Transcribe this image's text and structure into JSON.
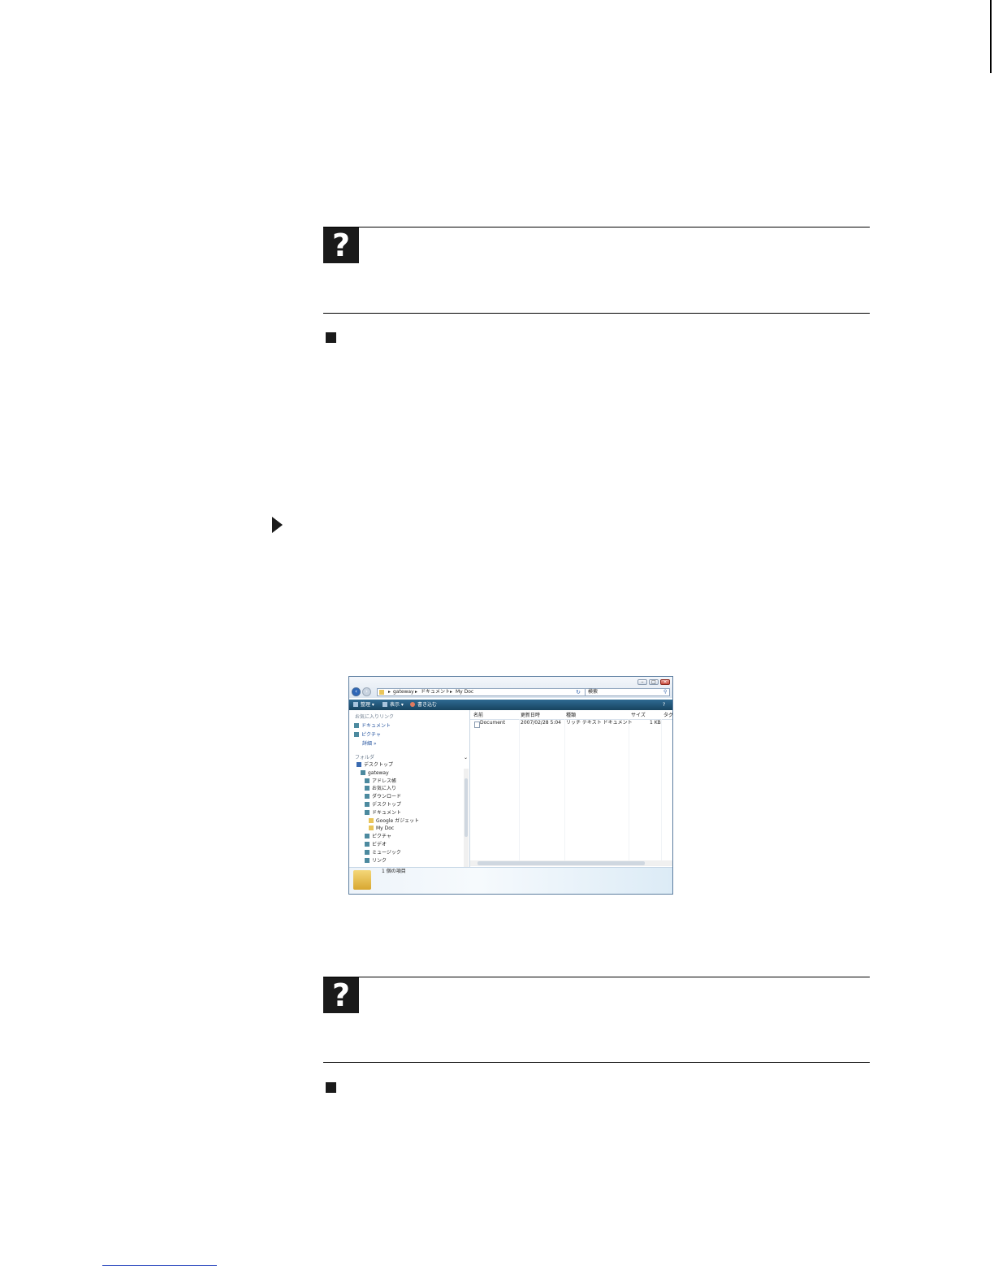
{
  "explorer": {
    "breadcrumb": [
      "gateway",
      "ドキュメント",
      "My Doc"
    ],
    "search_placeholder": "検索",
    "toolbar": [
      "整理 ▾",
      "表示 ▾",
      "書き込む"
    ],
    "favorites_header": "お気に入りリンク",
    "favorites": [
      "ドキュメント",
      "ピクチャ"
    ],
    "more_label": "詳細 »",
    "folders_header": "フォルダ",
    "tree": [
      {
        "label": "デスクトップ",
        "level": 0,
        "icon": "desktop-icon"
      },
      {
        "label": "gateway",
        "level": 1,
        "icon": "user-folder-icon"
      },
      {
        "label": "アドレス帳",
        "level": 2,
        "icon": "library-icon"
      },
      {
        "label": "お気に入り",
        "level": 2,
        "icon": "library-icon"
      },
      {
        "label": "ダウンロード",
        "level": 2,
        "icon": "library-icon"
      },
      {
        "label": "デスクトップ",
        "level": 2,
        "icon": "library-icon"
      },
      {
        "label": "ドキュメント",
        "level": 2,
        "icon": "library-icon"
      },
      {
        "label": "Google ガジェット",
        "level": 3,
        "icon": "folder-icon"
      },
      {
        "label": "My Doc",
        "level": 3,
        "icon": "folder-icon"
      },
      {
        "label": "ピクチャ",
        "level": 2,
        "icon": "library-icon"
      },
      {
        "label": "ビデオ",
        "level": 2,
        "icon": "library-icon"
      },
      {
        "label": "ミュージック",
        "level": 2,
        "icon": "library-icon"
      },
      {
        "label": "リンク",
        "level": 2,
        "icon": "library-icon"
      }
    ],
    "columns": [
      "名前",
      "更新日時",
      "種類",
      "サイズ",
      "タグ"
    ],
    "file": {
      "name": "Document",
      "date": "2007/02/28 5:04",
      "type": "リッチ テキスト ドキュメント",
      "size": "1 KB"
    },
    "status": "1 個の項目"
  }
}
